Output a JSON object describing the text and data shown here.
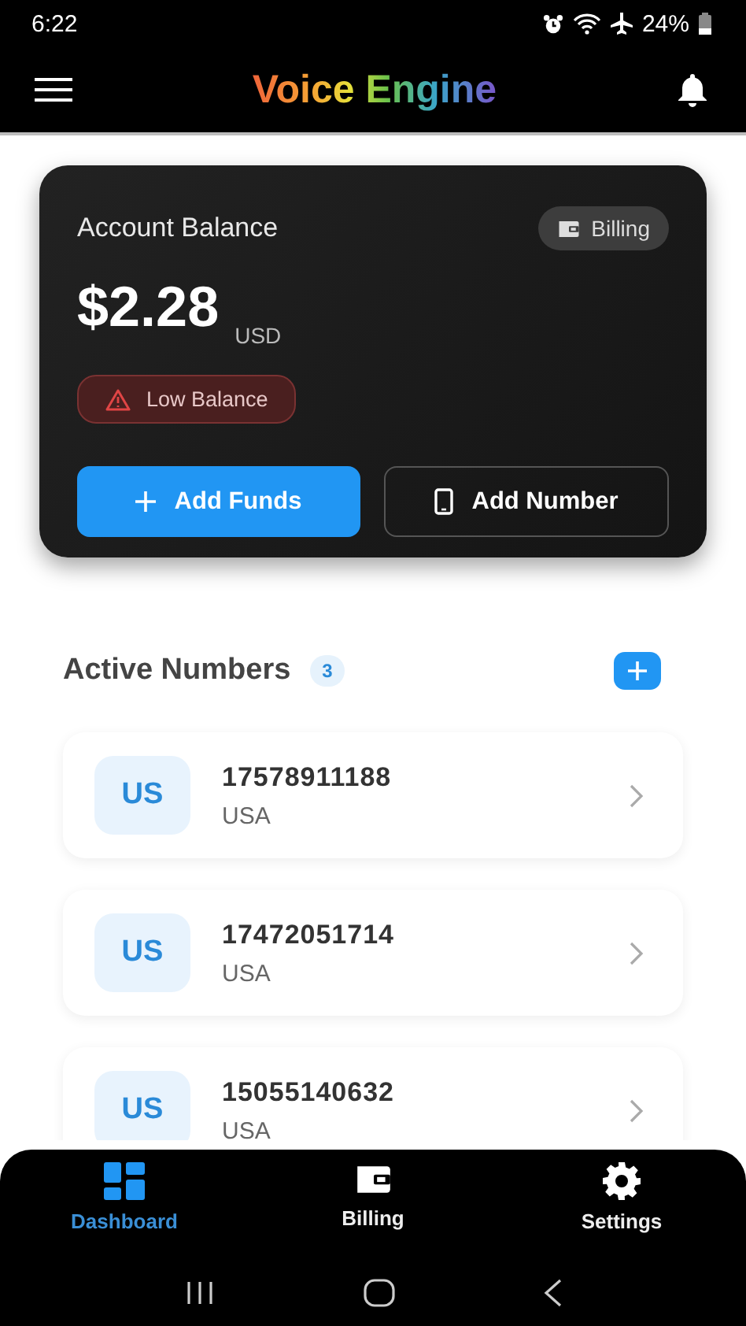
{
  "status_bar": {
    "time": "6:22",
    "battery": "24%"
  },
  "header": {
    "title": "Voice Engine"
  },
  "balance_card": {
    "title": "Account Balance",
    "billing_button": "Billing",
    "amount": "$2.28",
    "currency": "USD",
    "warning": "Low Balance",
    "buttons": [
      {
        "label": "Add Funds",
        "kind": "primary"
      },
      {
        "label": "Add Number",
        "kind": "outline"
      }
    ]
  },
  "active_numbers": {
    "title": "Active Numbers",
    "count": "3",
    "items": [
      {
        "flag": "US",
        "number": "17578911188",
        "country": "USA"
      },
      {
        "flag": "US",
        "number": "17472051714",
        "country": "USA"
      },
      {
        "flag": "US",
        "number": "15055140632",
        "country": "USA"
      }
    ]
  },
  "bottom_nav": [
    {
      "label": "Dashboard",
      "kind": "dashboard",
      "selected": true
    },
    {
      "label": "Billing",
      "kind": "wallet",
      "selected": false
    },
    {
      "label": "Settings",
      "kind": "gear",
      "selected": false
    }
  ]
}
